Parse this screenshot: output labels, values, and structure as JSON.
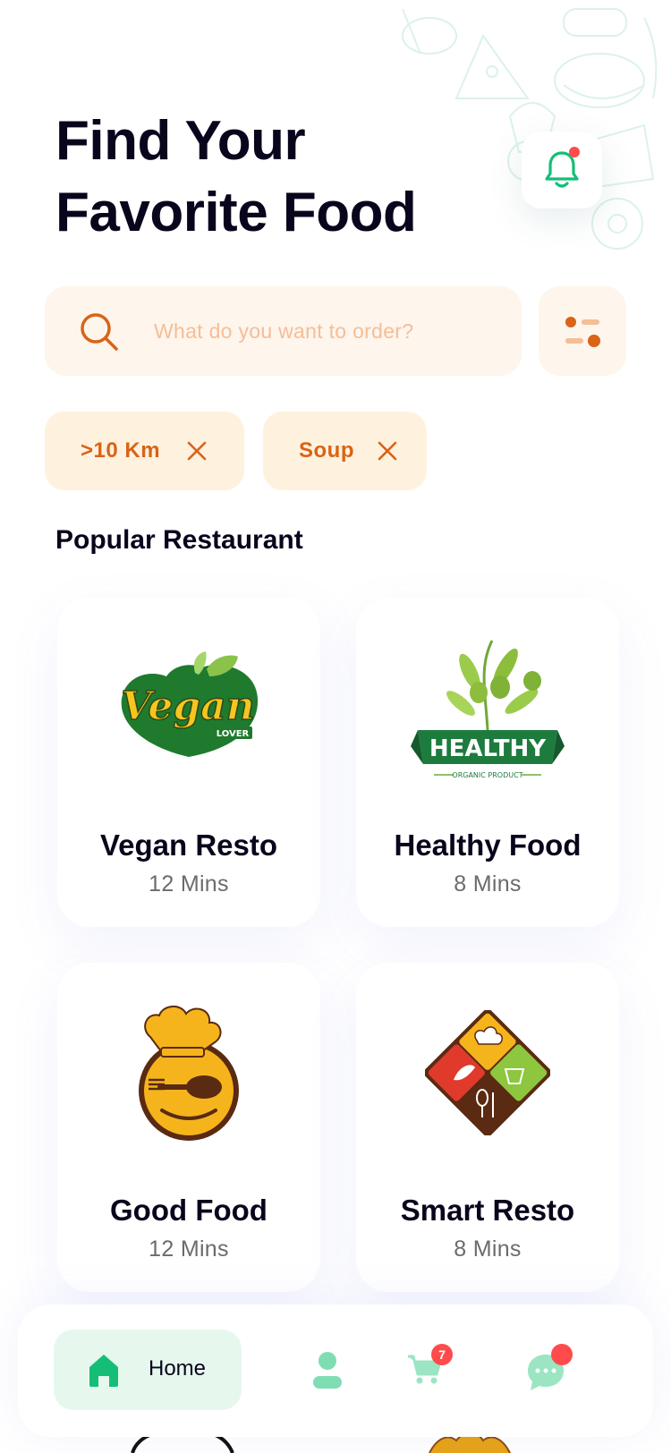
{
  "header": {
    "title_line1": "Find Your",
    "title_line2": "Favorite Food"
  },
  "search": {
    "placeholder": "What do you want to order?",
    "value": ""
  },
  "filters": [
    {
      "label": ">10 Km"
    },
    {
      "label": "Soup"
    }
  ],
  "section": {
    "title": "Popular Restaurant"
  },
  "restaurants": [
    {
      "name": "Vegan Resto",
      "time": "12 Mins",
      "logo_text": "Vegan",
      "logo_sub": "LOVER"
    },
    {
      "name": "Healthy Food",
      "time": "8 Mins",
      "logo_text": "HEALTHY",
      "logo_sub": "ORGANIC PRODUCT"
    },
    {
      "name": "Good Food",
      "time": "12 Mins"
    },
    {
      "name": "Smart Resto",
      "time": "8 Mins"
    }
  ],
  "nav": {
    "home_label": "Home",
    "cart_count": "7"
  },
  "colors": {
    "accent_green": "#15BE77",
    "accent_orange": "#DA6317",
    "badge_red": "#FF4B4B"
  }
}
